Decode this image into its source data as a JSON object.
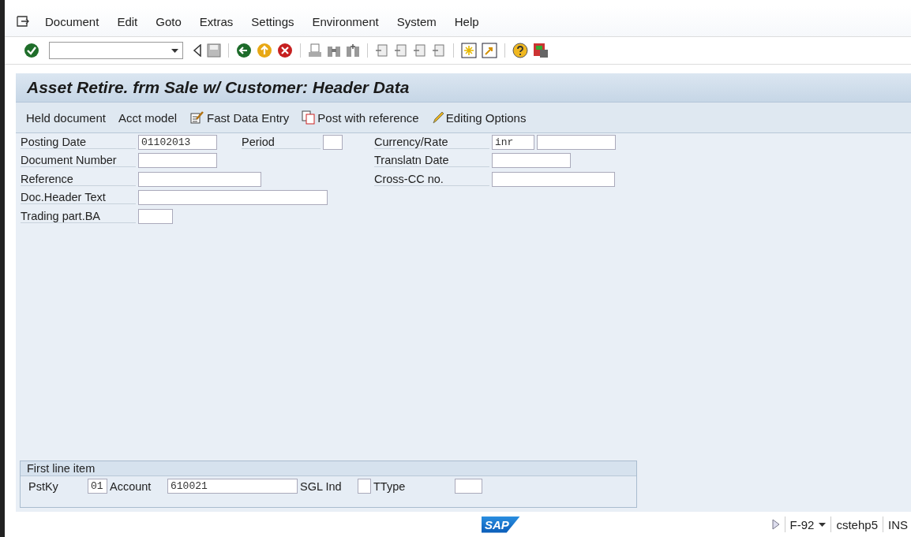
{
  "menu_bar": [
    "Document",
    "Edit",
    "Goto",
    "Extras",
    "Settings",
    "Environment",
    "System",
    "Help"
  ],
  "title": "Asset Retire. frm Sale w/ Customer: Header Data",
  "app_toolbar": [
    {
      "label": "Held document",
      "kind": "text"
    },
    {
      "label": "Acct model",
      "kind": "text"
    },
    {
      "label": "Fast Data Entry",
      "kind": "fast"
    },
    {
      "label": "Post with reference",
      "kind": "copy"
    },
    {
      "label": "Editing Options",
      "kind": "pencil"
    }
  ],
  "header_fields_left": [
    {
      "label": "Posting Date",
      "value": "01102013"
    },
    {
      "label": "Document Number"
    },
    {
      "label": "Reference"
    },
    {
      "label": "Doc.Header Text"
    },
    {
      "label": "Trading part.BA"
    }
  ],
  "period": {
    "label": "Period"
  },
  "header_fields_right": [
    {
      "label": "Currency/Rate",
      "value": "inr"
    },
    {
      "label": "Translatn Date"
    },
    {
      "label": "Cross-CC no."
    }
  ],
  "first_line_item": {
    "title": "First line item",
    "fields": [
      {
        "label": "PstKy",
        "value": "01"
      },
      {
        "label": "Account",
        "value": "610021"
      },
      {
        "label": "SGL Ind"
      },
      {
        "label": "TType"
      }
    ]
  },
  "status_bar": {
    "logo": "SAP",
    "transaction": "F-92",
    "server": "cstehp5",
    "mode": "INS"
  }
}
